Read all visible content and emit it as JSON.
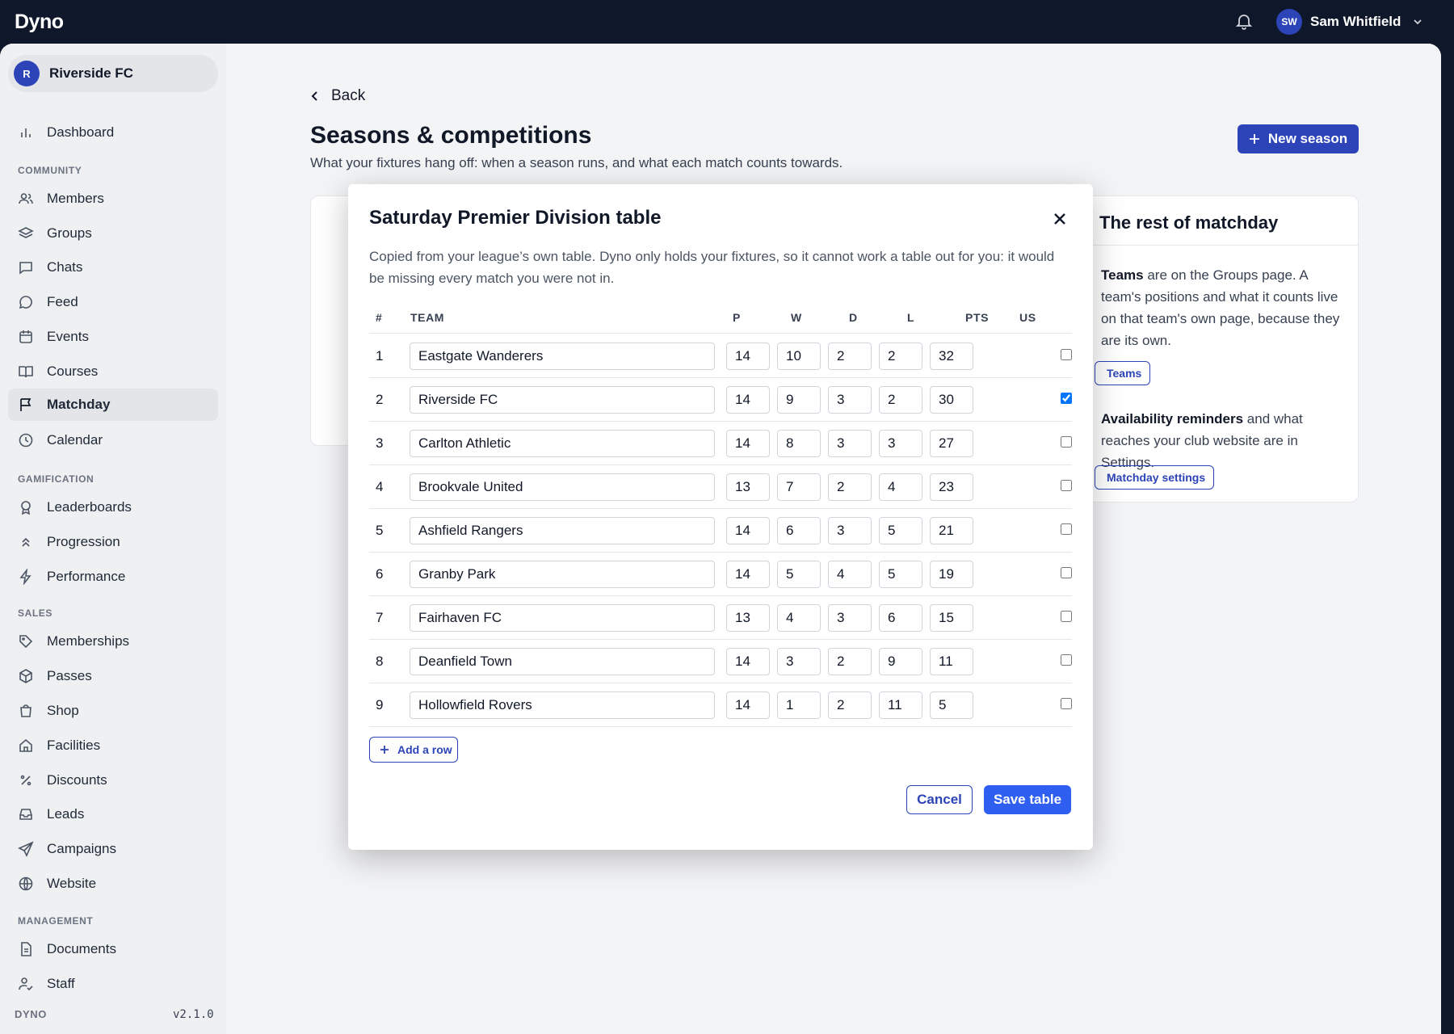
{
  "app": {
    "brand": "Dyno"
  },
  "user": {
    "initials": "SW",
    "name": "Sam Whitfield"
  },
  "club": {
    "initial": "R",
    "name": "Riverside FC"
  },
  "sidebar": {
    "top": [
      {
        "label": "Dashboard"
      }
    ],
    "sections": [
      {
        "title": "COMMUNITY",
        "items": [
          {
            "label": "Members"
          },
          {
            "label": "Groups"
          },
          {
            "label": "Chats"
          },
          {
            "label": "Feed"
          },
          {
            "label": "Events"
          },
          {
            "label": "Courses"
          },
          {
            "label": "Matchday"
          },
          {
            "label": "Calendar"
          }
        ]
      },
      {
        "title": "GAMIFICATION",
        "items": [
          {
            "label": "Leaderboards"
          },
          {
            "label": "Progression"
          },
          {
            "label": "Performance"
          }
        ]
      },
      {
        "title": "SALES",
        "items": [
          {
            "label": "Memberships"
          },
          {
            "label": "Passes"
          },
          {
            "label": "Shop"
          },
          {
            "label": "Facilities"
          },
          {
            "label": "Discounts"
          },
          {
            "label": "Leads"
          },
          {
            "label": "Campaigns"
          },
          {
            "label": "Website"
          }
        ]
      },
      {
        "title": "MANAGEMENT",
        "items": [
          {
            "label": "Documents"
          },
          {
            "label": "Staff"
          }
        ]
      }
    ],
    "active": "Matchday",
    "footer": {
      "brand": "DYNO",
      "version": "v2.1.0"
    }
  },
  "page": {
    "back_label": "Back",
    "title": "Seasons & competitions",
    "subtitle": "What your fixtures hang off: when a season runs, and what each match counts towards.",
    "new_season_label": "New season"
  },
  "right_card": {
    "title": "The rest of matchday",
    "p1_bold": "Teams",
    "p1_rest": " are on the Groups page. A team's positions and what it counts live on that team's own page, because they are its own.",
    "btn1": "Teams",
    "p2_bold": "Availability reminders",
    "p2_rest": " and what reaches your club website are in Settings.",
    "btn2": "Matchday settings"
  },
  "modal": {
    "title": "Saturday Premier Division table",
    "description": "Copied from your league’s own table. Dyno only holds your fixtures, so it cannot work a table out for you: it would be missing every match you were not in.",
    "columns": [
      "#",
      "TEAM",
      "P",
      "W",
      "D",
      "L",
      "PTS",
      "US"
    ],
    "rows": [
      {
        "pos": "1",
        "team": "Eastgate Wanderers",
        "p": "14",
        "w": "10",
        "d": "2",
        "l": "2",
        "pts": "32",
        "us": false
      },
      {
        "pos": "2",
        "team": "Riverside FC",
        "p": "14",
        "w": "9",
        "d": "3",
        "l": "2",
        "pts": "30",
        "us": true
      },
      {
        "pos": "3",
        "team": "Carlton Athletic",
        "p": "14",
        "w": "8",
        "d": "3",
        "l": "3",
        "pts": "27",
        "us": false
      },
      {
        "pos": "4",
        "team": "Brookvale United",
        "p": "13",
        "w": "7",
        "d": "2",
        "l": "4",
        "pts": "23",
        "us": false
      },
      {
        "pos": "5",
        "team": "Ashfield Rangers",
        "p": "14",
        "w": "6",
        "d": "3",
        "l": "5",
        "pts": "21",
        "us": false
      },
      {
        "pos": "6",
        "team": "Granby Park",
        "p": "14",
        "w": "5",
        "d": "4",
        "l": "5",
        "pts": "19",
        "us": false
      },
      {
        "pos": "7",
        "team": "Fairhaven FC",
        "p": "13",
        "w": "4",
        "d": "3",
        "l": "6",
        "pts": "15",
        "us": false
      },
      {
        "pos": "8",
        "team": "Deanfield Town",
        "p": "14",
        "w": "3",
        "d": "2",
        "l": "9",
        "pts": "11",
        "us": false
      },
      {
        "pos": "9",
        "team": "Hollowfield Rovers",
        "p": "14",
        "w": "1",
        "d": "2",
        "l": "11",
        "pts": "5",
        "us": false
      }
    ],
    "add_row_label": "Add a row",
    "cancel_label": "Cancel",
    "save_label": "Save table"
  },
  "colors": {
    "accent": "#2c44b8",
    "primary_button": "#2f5ff0",
    "topbar": "#0f172a"
  }
}
